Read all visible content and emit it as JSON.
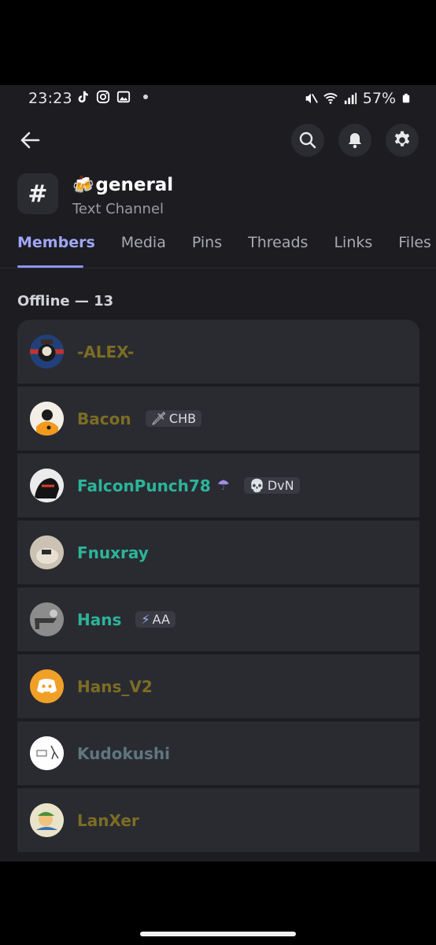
{
  "status_bar": {
    "time": "23:23",
    "battery": "57%"
  },
  "channel": {
    "emoji": "🍻",
    "name": "general",
    "type": "Text Channel",
    "hash_symbol": "#"
  },
  "tabs": [
    {
      "label": "Members",
      "active": true
    },
    {
      "label": "Media"
    },
    {
      "label": "Pins"
    },
    {
      "label": "Threads"
    },
    {
      "label": "Links"
    },
    {
      "label": "Files"
    }
  ],
  "section": {
    "label": "Offline — 13"
  },
  "members": [
    {
      "name": "-ALEX-",
      "color": "#7c6d24"
    },
    {
      "name": "Bacon",
      "color": "#7c6d24",
      "tag": {
        "emoji": "🗡",
        "text": "CHB"
      }
    },
    {
      "name": "FalconPunch78",
      "color": "#2bb59a",
      "emoji": "☂",
      "tag": {
        "emoji": "💀",
        "text": "DvN"
      }
    },
    {
      "name": "Fnuxray",
      "color": "#2bb59a"
    },
    {
      "name": "Hans",
      "color": "#2bb59a",
      "tag": {
        "emoji": "⚡",
        "text": "AA"
      }
    },
    {
      "name": "Hans_V2",
      "color": "#7c6d24"
    },
    {
      "name": "Kudokushi",
      "color": "#5f7680"
    },
    {
      "name": "LanXer",
      "color": "#7c6d24"
    }
  ],
  "colors": {
    "accent": "#8b93f0",
    "background": "#1c1c21",
    "card": "#2a2b31"
  },
  "icons": [
    "back-arrow-icon",
    "search-icon",
    "bell-icon",
    "gear-icon"
  ]
}
